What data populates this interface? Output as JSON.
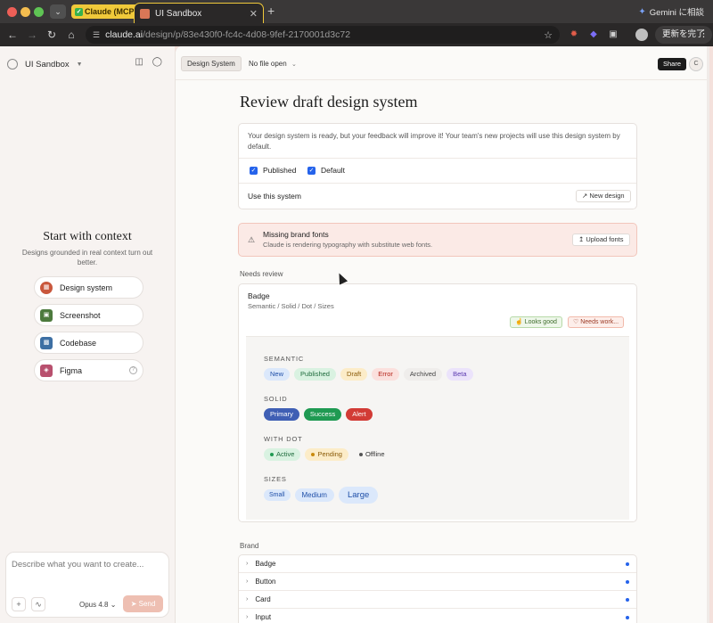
{
  "browser": {
    "tabs": [
      {
        "label": "Claude (MCP)"
      },
      {
        "label": "UI Sandbox"
      }
    ],
    "url_host": "claude.ai",
    "url_path": "/design/p/83e430f0-fc4c-4d08-9fef-2170001d3c72",
    "gemini_label": "Gemini に相談",
    "update_label": "更新を完了"
  },
  "sidebar": {
    "project_name": "UI Sandbox",
    "context_title": "Start with context",
    "context_subtitle": "Designs grounded in real context turn out better.",
    "items": [
      {
        "label": "Design system",
        "icon": "design-system-icon",
        "color": "#c9573c"
      },
      {
        "label": "Screenshot",
        "icon": "screenshot-icon",
        "color": "#4c7a3d"
      },
      {
        "label": "Codebase",
        "icon": "codebase-icon",
        "color": "#3d6fa3"
      },
      {
        "label": "Figma",
        "icon": "figma-icon",
        "color": "#b8506e"
      }
    ],
    "composer": {
      "placeholder": "Describe what you want to create...",
      "model": "Opus 4.8",
      "send_label": "Send"
    }
  },
  "topbar": {
    "design_system_label": "Design System",
    "file_label": "No file open",
    "share_label": "Share",
    "avatar_initial": "C"
  },
  "page": {
    "title": "Review draft design system",
    "intro_text": "Your design system is ready, but your feedback will improve it! Your team's new projects will use this design system by default.",
    "published_label": "Published",
    "default_label": "Default",
    "use_label": "Use this system",
    "new_design_label": "New design"
  },
  "alert": {
    "title": "Missing brand fonts",
    "subtitle": "Claude is rendering typography with substitute web fonts.",
    "button": "Upload fonts"
  },
  "review": {
    "section_label": "Needs review",
    "title": "Badge",
    "subtitle": "Semantic / Solid / Dot / Sizes",
    "looks_good": "Looks good",
    "needs_work": "Needs work...",
    "groups": {
      "semantic": {
        "label": "SEMANTIC",
        "items": [
          {
            "label": "New",
            "bg": "#dbe8fb",
            "fg": "#1f4fa8"
          },
          {
            "label": "Published",
            "bg": "#d9f2e1",
            "fg": "#1e6b3c"
          },
          {
            "label": "Draft",
            "bg": "#fcecc8",
            "fg": "#8a5a06"
          },
          {
            "label": "Error",
            "bg": "#fbe0dd",
            "fg": "#b42318"
          },
          {
            "label": "Archived",
            "bg": "#efedeb",
            "fg": "#444444"
          },
          {
            "label": "Beta",
            "bg": "#ebe3fb",
            "fg": "#5b3ab0"
          }
        ]
      },
      "solid": {
        "label": "SOLID",
        "items": [
          {
            "label": "Primary",
            "bg": "#3f5fb4",
            "fg": "#ffffff"
          },
          {
            "label": "Success",
            "bg": "#1f9a52",
            "fg": "#ffffff"
          },
          {
            "label": "Alert",
            "bg": "#d23b35",
            "fg": "#ffffff"
          }
        ]
      },
      "dot": {
        "label": "WITH DOT",
        "items": [
          {
            "label": "Active",
            "bg": "#d9f2e1",
            "fg": "#1e6b3c",
            "dot": "#1f9a52"
          },
          {
            "label": "Pending",
            "bg": "#fcecc8",
            "fg": "#8a5a06",
            "dot": "#c98a0c"
          },
          {
            "label": "Offline",
            "bg": "#f6f5f3",
            "fg": "#333333",
            "dot": "#555555"
          }
        ]
      },
      "sizes": {
        "label": "SIZES",
        "items": [
          {
            "label": "Small",
            "bg": "#dbe8fb",
            "fg": "#1f4fa8"
          },
          {
            "label": "Medium",
            "bg": "#dbe8fb",
            "fg": "#1f4fa8"
          },
          {
            "label": "Large",
            "bg": "#dbe8fb",
            "fg": "#1f4fa8"
          }
        ]
      }
    }
  },
  "brand": {
    "section_label": "Brand",
    "items": [
      {
        "label": "Badge"
      },
      {
        "label": "Button"
      },
      {
        "label": "Card"
      },
      {
        "label": "Input"
      }
    ]
  }
}
